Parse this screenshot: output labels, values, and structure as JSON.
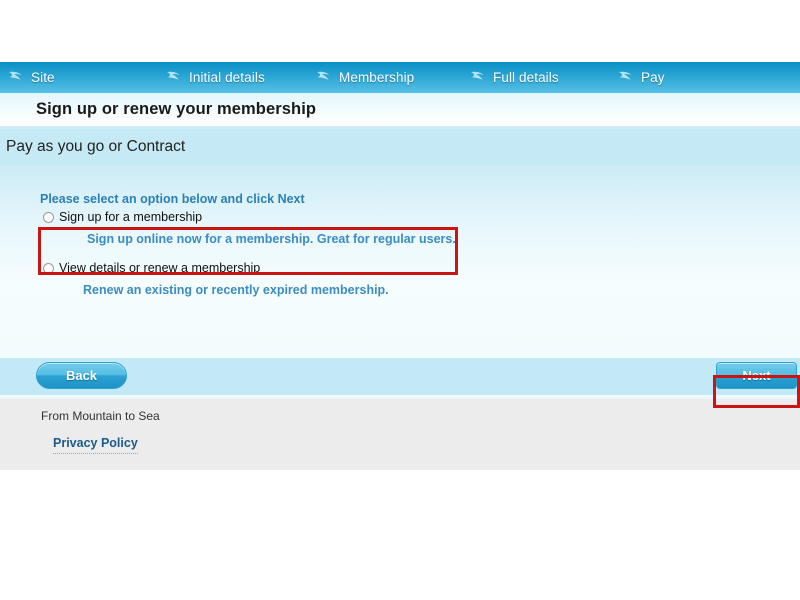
{
  "stepnav": {
    "icon": "arrow-swoosh-icon",
    "steps": [
      {
        "label": "Site"
      },
      {
        "label": "Initial details"
      },
      {
        "label": "Membership"
      },
      {
        "label": "Full details"
      },
      {
        "label": "Pay"
      }
    ]
  },
  "header": {
    "title": "Sign up or renew your membership"
  },
  "section": {
    "heading": "Pay as you go or Contract"
  },
  "main": {
    "instructions": "Please select an option below and click Next",
    "options": [
      {
        "title": "Sign up for a membership",
        "description": "Sign up online now for a membership. Great for regular users.",
        "selected": false
      },
      {
        "title": "View details or renew a membership",
        "description": "Renew an existing or recently expired membership.",
        "selected": false
      }
    ]
  },
  "buttons": {
    "back_label": "Back",
    "next_label": "Next"
  },
  "footer": {
    "tagline": "From Mountain to Sea",
    "privacy_link": "Privacy Policy"
  },
  "colors": {
    "nav_dark": "#0b8fc4",
    "nav_light": "#57c0e4",
    "section_band": "#c5eaf5",
    "button_bar": "#c3e9f6",
    "link_blue": "#3b8cc0",
    "highlight_red": "#cc1414",
    "footer_gray": "#ececec"
  }
}
